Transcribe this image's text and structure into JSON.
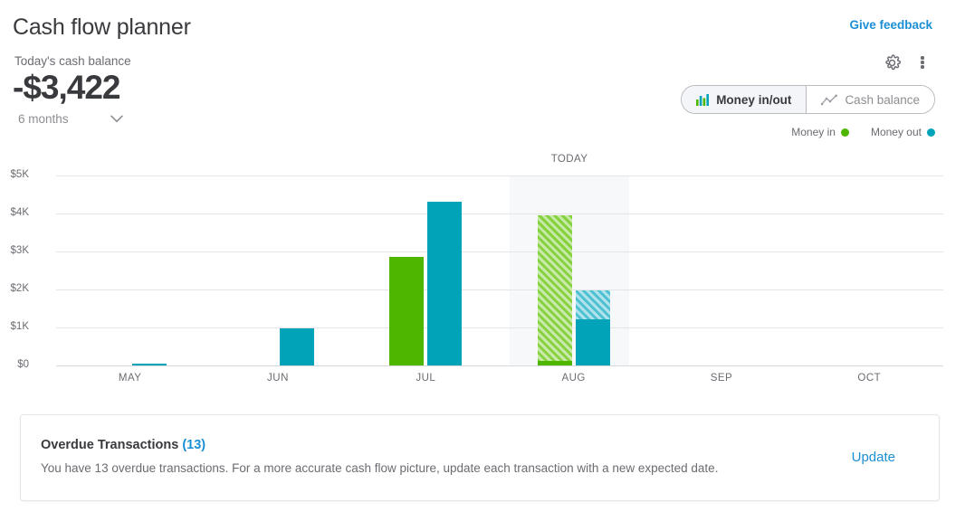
{
  "header": {
    "title": "Cash flow planner",
    "give_feedback": "Give feedback",
    "balance_label": "Today's cash balance",
    "balance_value": "-$3,422",
    "range_value": "6 months",
    "gear_icon": "gear-icon",
    "kebab_icon": "more-vertical-icon",
    "chevron_icon": "chevron-down-icon"
  },
  "view_toggle": {
    "options": [
      {
        "label": "Money in/out",
        "icon": "bar-chart-icon",
        "active": true
      },
      {
        "label": "Cash balance",
        "icon": "line-chart-icon",
        "active": false
      }
    ]
  },
  "legend": {
    "items": [
      {
        "label": "Money in",
        "color": "#4fb600"
      },
      {
        "label": "Money out",
        "color": "#00a3b8"
      }
    ]
  },
  "colors": {
    "money_in": "#4fb600",
    "money_out": "#00a3b8",
    "money_in_projected": "#86d13f",
    "money_out_projected": "#4cc0d2",
    "link": "#1b8fd4",
    "today_band": "#f7f8f9",
    "gridline": "#e3e5e8"
  },
  "chart_data": {
    "type": "bar",
    "title": "",
    "xlabel": "",
    "ylabel": "",
    "ylim": [
      0,
      5000
    ],
    "grid": true,
    "legend_position": "top-right",
    "ytick_labels": [
      "$5K",
      "$4K",
      "$3K",
      "$2K",
      "$1K",
      "$0"
    ],
    "ytick_values": [
      5000,
      4000,
      3000,
      2000,
      1000,
      0
    ],
    "categories": [
      "MAY",
      "JUN",
      "JUL",
      "AUG",
      "SEP",
      "OCT"
    ],
    "annotations": [
      {
        "text": "TODAY",
        "category": "AUG"
      }
    ],
    "series": [
      {
        "name": "Money in",
        "color": "#4fb600",
        "values": [
          0,
          0,
          2850,
          3950,
          0,
          0
        ],
        "actual": [
          0,
          0,
          2850,
          120,
          0,
          0
        ],
        "projected": [
          0,
          0,
          0,
          3830,
          0,
          0
        ]
      },
      {
        "name": "Money out",
        "color": "#00a3b8",
        "values": [
          50,
          980,
          4300,
          1970,
          0,
          0
        ],
        "actual": [
          50,
          980,
          4300,
          1220,
          0,
          0
        ],
        "projected": [
          0,
          0,
          0,
          750,
          0,
          0
        ]
      }
    ]
  },
  "banner": {
    "title": "Overdue Transactions",
    "count": "(13)",
    "text": "You have 13 overdue transactions. For a more accurate cash flow picture, update each transaction with a new expected date.",
    "action": "Update"
  }
}
